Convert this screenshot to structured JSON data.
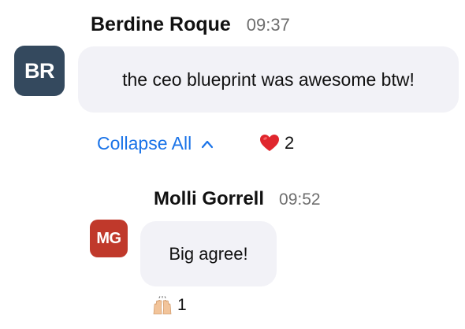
{
  "messages": [
    {
      "initials": "BR",
      "avatar_color": "#34495e",
      "sender": "Berdine Roque",
      "time": "09:37",
      "text": "the ceo blueprint was awesome btw!"
    },
    {
      "initials": "MG",
      "avatar_color": "#c0392b",
      "sender": "Molli Gorrell",
      "time": "09:52",
      "text": "Big agree!"
    }
  ],
  "thread": {
    "collapse_label": "Collapse All",
    "collapse_icon": "chevron-up-icon",
    "accent_color": "#1a73e8"
  },
  "reactions": [
    {
      "icon": "red-heart-icon",
      "count": "2"
    },
    {
      "icon": "raising-hands-icon",
      "count": "1"
    }
  ]
}
